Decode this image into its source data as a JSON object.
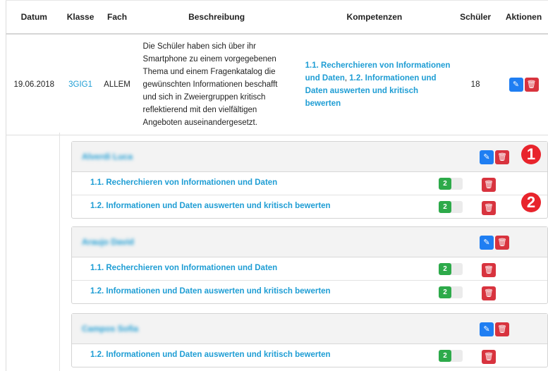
{
  "table": {
    "headers": [
      "Datum",
      "Klasse",
      "Fach",
      "Beschreibung",
      "Kompetenzen",
      "Schüler",
      "Aktionen"
    ],
    "row": {
      "datum": "19.06.2018",
      "klasse": "3GIG1",
      "fach": "ALLEM",
      "beschreibung": "Die Schüler haben sich über ihr Smartphone zu einem vorgegebenen Thema und einem Fragenkatalog die gewünschten Informationen beschafft und sich in Zweiergruppen kritisch reflektierend mit den vielfältigen Angeboten auseinandergesetzt.",
      "kompetenzen": [
        "1.1. Recherchieren von Informationen und Daten",
        "1.2. Informationen und Daten auswerten und kritisch bewerten"
      ],
      "kompetenzen_separator": ", ",
      "schueler": "18"
    }
  },
  "students": [
    {
      "name": "Alverdi Luca",
      "items": [
        {
          "label": "1.1. Recherchieren von Informationen und Daten",
          "level": "2"
        },
        {
          "label": "1.2. Informationen und Daten auswerten und kritisch bewerten",
          "level": "2"
        }
      ]
    },
    {
      "name": "Araujo David",
      "items": [
        {
          "label": "1.1. Recherchieren von Informationen und Daten",
          "level": "2"
        },
        {
          "label": "1.2. Informationen und Daten auswerten und kritisch bewerten",
          "level": "2"
        }
      ]
    },
    {
      "name": "Campos Sofia",
      "items": [
        {
          "label": "1.2. Informationen und Daten auswerten und kritisch bewerten",
          "level": "2"
        }
      ]
    }
  ],
  "annotations": {
    "marker_1": "1",
    "marker_2": "2"
  },
  "icons": {
    "edit": "edit-icon",
    "delete": "trash-icon"
  },
  "colors": {
    "link": "#1e9dd4",
    "edit": "#1f7ef2",
    "delete": "#d8333e",
    "level": "#2daa4a",
    "annotation": "#e8242c"
  }
}
